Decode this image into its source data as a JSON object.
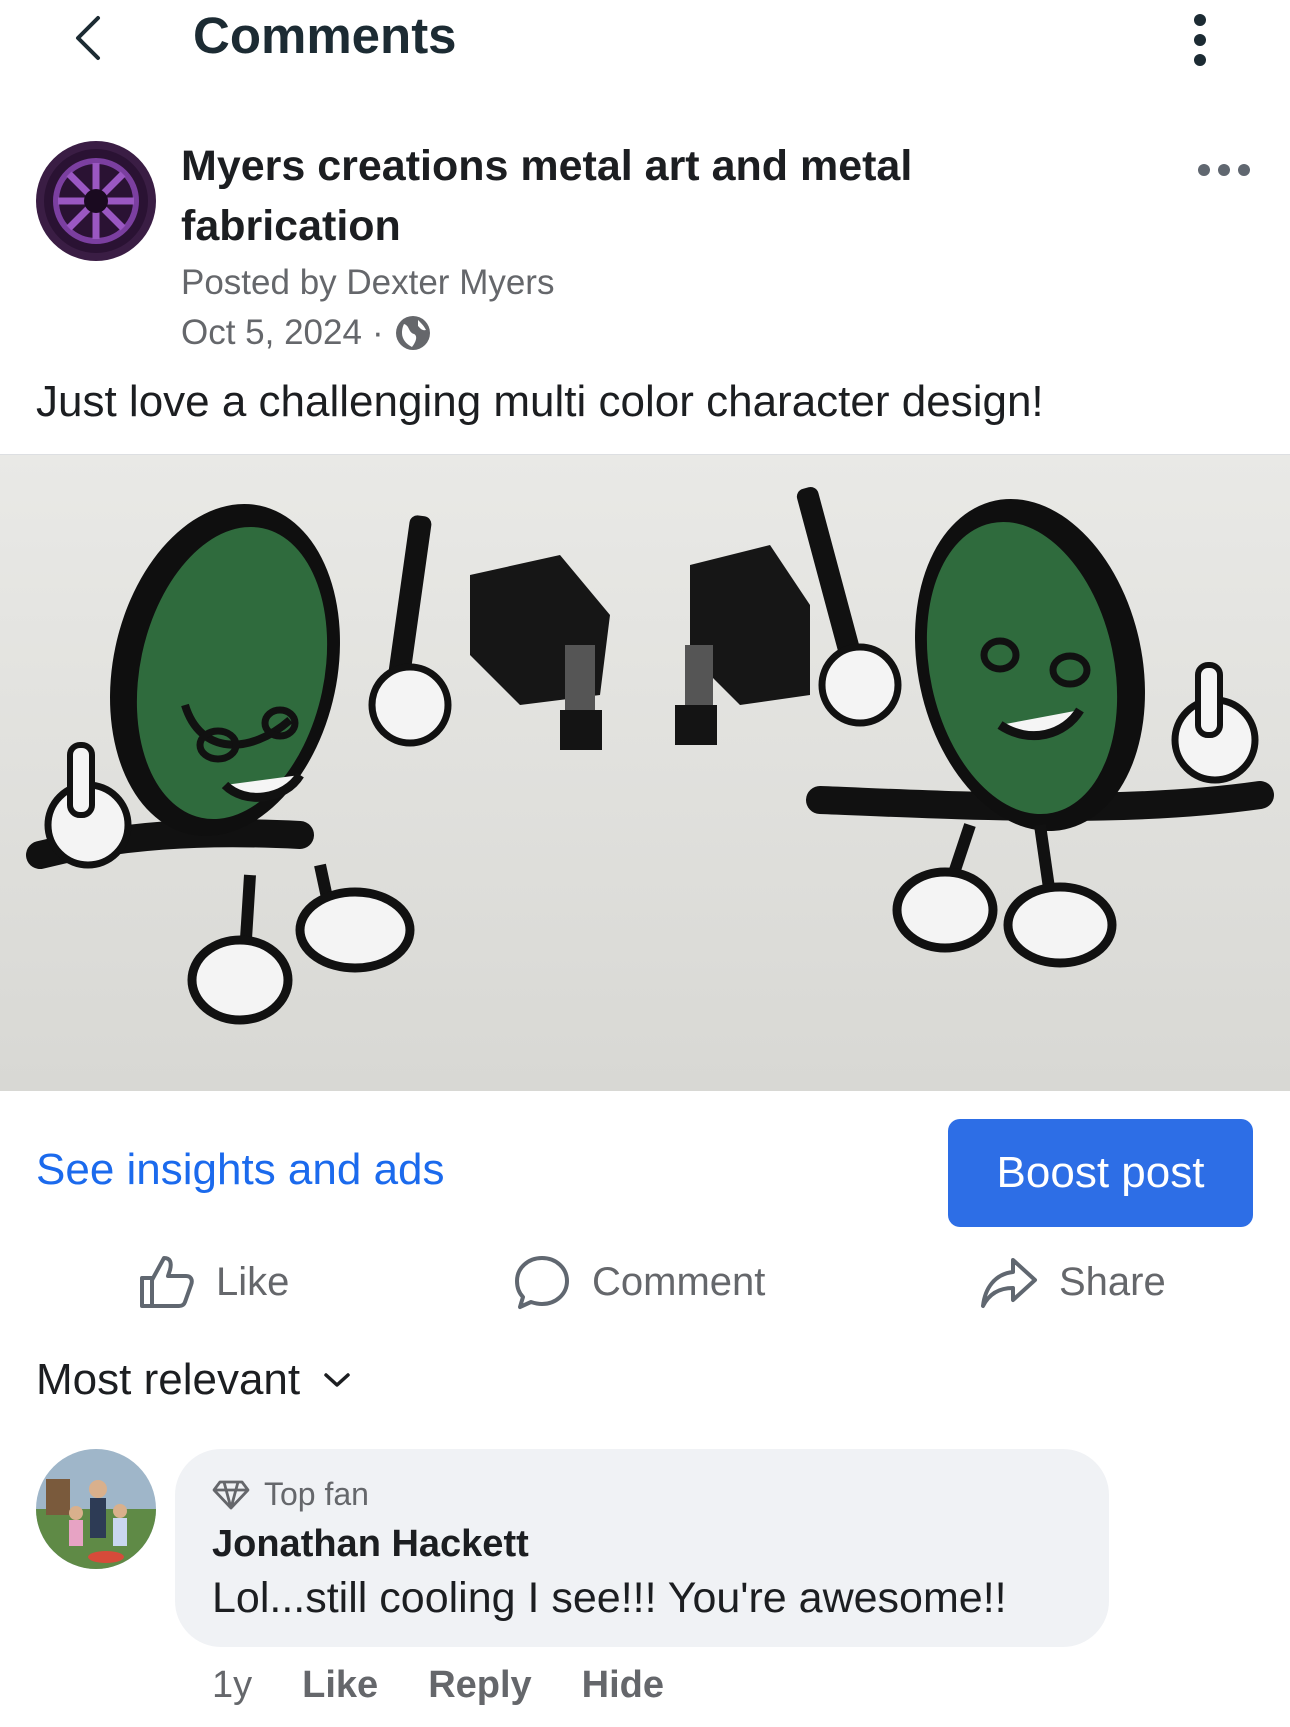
{
  "top_bar": {
    "title": "Comments"
  },
  "post": {
    "page_name": "Myers creations metal art and metal fabrication",
    "posted_by": "Posted by Dexter Myers",
    "date": "Oct 5, 2024",
    "separator": "·",
    "audience_icon": "globe-icon",
    "text": "Just love a challenging multi color character design!"
  },
  "promo": {
    "insights_label": "See insights and ads",
    "boost_label": "Boost post",
    "accent_color": "#2d6ee6"
  },
  "actions": {
    "like_label": "Like",
    "comment_label": "Comment",
    "share_label": "Share"
  },
  "sort": {
    "label": "Most relevant"
  },
  "comment": {
    "badge": "Top fan",
    "author": "Jonathan Hackett",
    "text": "Lol...still cooling I see!!!  You're awesome!!",
    "age": "1y",
    "like_label": "Like",
    "reply_label": "Reply",
    "hide_label": "Hide"
  }
}
